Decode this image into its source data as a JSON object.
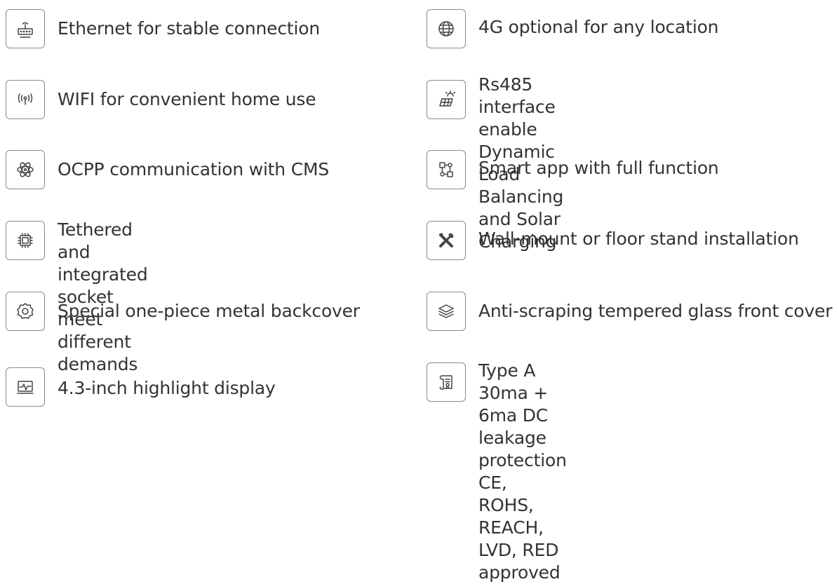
{
  "features_left": [
    {
      "icon": "router-icon",
      "lines": [
        "Ethernet for stable connection"
      ]
    },
    {
      "icon": "wifi-icon",
      "lines": [
        "WIFI for convenient home use"
      ]
    },
    {
      "icon": "atom-icon",
      "lines": [
        "OCPP communication with CMS"
      ]
    },
    {
      "icon": "chip-icon",
      "lines": [
        "Tethered and integrated socket meet",
        "different demands"
      ]
    },
    {
      "icon": "gear-icon",
      "lines": [
        "Special one-piece metal backcover"
      ]
    },
    {
      "icon": "display-icon",
      "lines": [
        "4.3-inch highlight display"
      ]
    }
  ],
  "features_right": [
    {
      "icon": "globe-icon",
      "lines": [
        "4G optional for any location"
      ]
    },
    {
      "icon": "solar-panel-icon",
      "lines": [
        "Rs485 interface enable Dynamic Load",
        "Balancing and Solar Charging"
      ]
    },
    {
      "icon": "app-flow-icon",
      "lines": [
        "Smart app with full function"
      ]
    },
    {
      "icon": "tools-icon",
      "lines": [
        "Wall-mount or floor stand installation"
      ]
    },
    {
      "icon": "layers-icon",
      "lines": [
        "Anti-scraping tempered glass front cover"
      ]
    },
    {
      "icon": "certificate-icon",
      "lines": [
        "Type A 30ma + 6ma DC leakage protection",
        "CE, ROHS, REACH, LVD, RED approved"
      ]
    }
  ]
}
